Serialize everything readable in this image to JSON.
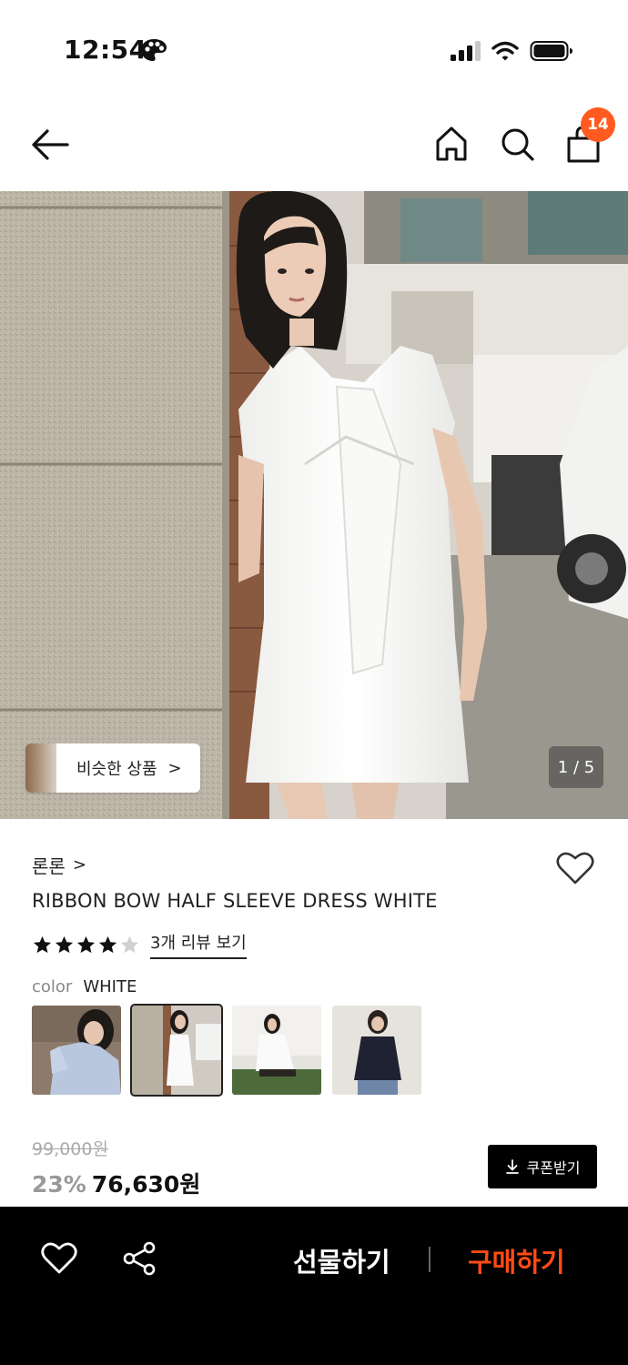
{
  "status_bar": {
    "time": "12:54",
    "icons": [
      "palette-icon",
      "signal-icon",
      "wifi-icon",
      "battery-icon"
    ]
  },
  "nav": {
    "icons": [
      "back-arrow-icon",
      "home-icon",
      "search-icon",
      "shopping-bag-icon"
    ],
    "cart_badge": "14",
    "badge_color": "#ff5a1f"
  },
  "gallery": {
    "similar_label": "비슷한 상품",
    "similar_chevron": ">",
    "page_indicator": "1 / 5"
  },
  "product": {
    "brand": "론론",
    "brand_chevron": ">",
    "title": "RIBBON BOW HALF SLEEVE DRESS WHITE",
    "rating_stars": 4,
    "rating_max": 5,
    "review_link": "3개 리뷰 보기",
    "color_label": "color",
    "color_value": "WHITE",
    "swatches": [
      {
        "name": "light-blue-dress",
        "selected": false
      },
      {
        "name": "white-dress",
        "selected": true
      },
      {
        "name": "white-dress-seated",
        "selected": false
      },
      {
        "name": "navy-dress",
        "selected": false
      }
    ],
    "original_price": "99,000원",
    "discount": "23%",
    "sale_price": "76,630원",
    "coupon_label": "쿠폰받기",
    "coupon_icon": "download-icon"
  },
  "bottom_bar": {
    "gift_label": "선물하기",
    "buy_label": "구매하기",
    "buy_color": "#ff4b14",
    "icons": [
      "heart-icon",
      "share-icon"
    ]
  }
}
